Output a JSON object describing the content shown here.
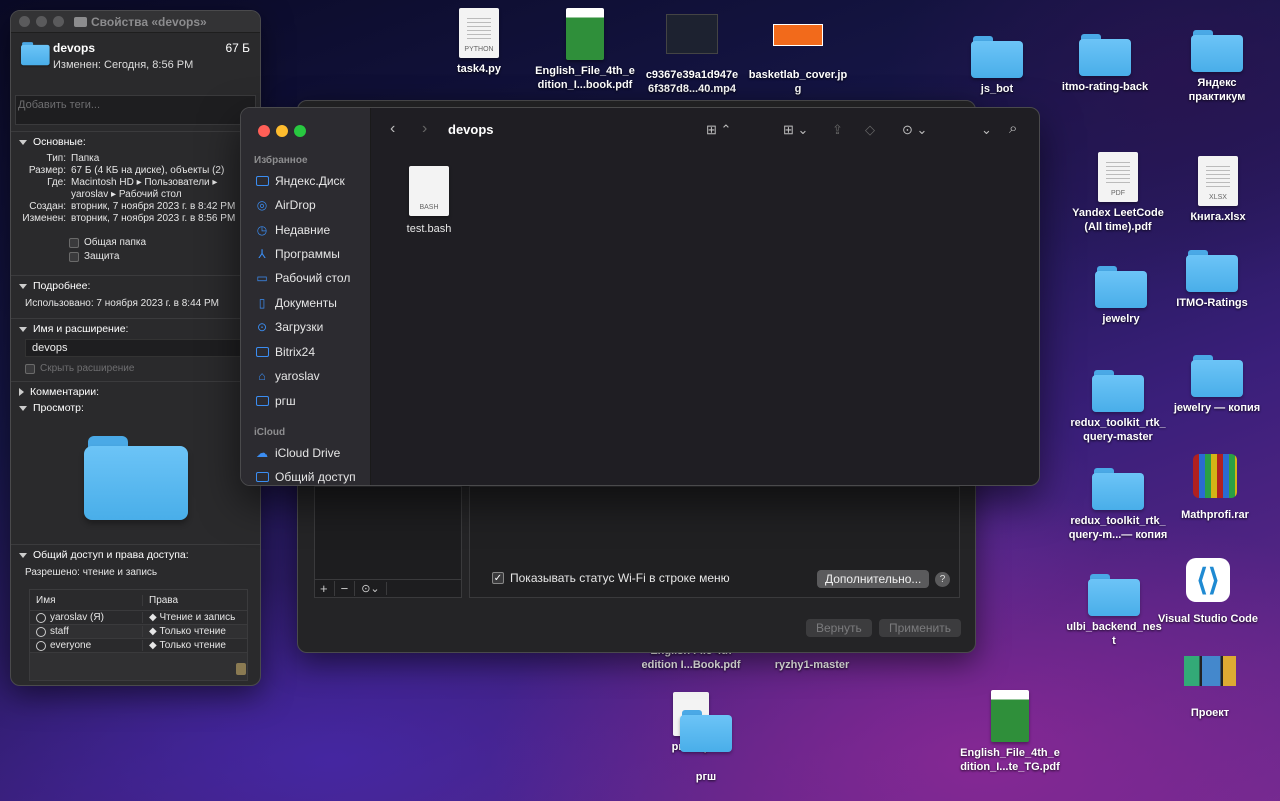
{
  "desktop": {
    "items": [
      {
        "label": "task4.py",
        "kind": "doc",
        "ext": "PYTHON"
      },
      {
        "label": "English_File_4th_e\ndition_I...book.pdf",
        "kind": "book"
      },
      {
        "label": "c9367e39a1d947e\n6f387d8...40.mp4",
        "kind": "video"
      },
      {
        "label": "basketlab_cover.jp\ng",
        "kind": "image"
      },
      {
        "label": "js_bot",
        "kind": "folder"
      },
      {
        "label": "itmo-rating-back",
        "kind": "folder"
      },
      {
        "label": "Яндекс\nпрактикум",
        "kind": "folder"
      },
      {
        "label": "Yandex LeetCode\n(All time).pdf",
        "kind": "doc",
        "ext": "PDF"
      },
      {
        "label": "Книга.xlsx",
        "kind": "doc",
        "ext": "XLSX"
      },
      {
        "label": "jewelry",
        "kind": "folder"
      },
      {
        "label": "ITMO-Ratings",
        "kind": "folder"
      },
      {
        "label": "jewelry — копия",
        "kind": "folder"
      },
      {
        "label": "redux_toolkit_rtk_\nquery-master",
        "kind": "folder"
      },
      {
        "label": "Mathprofi.rar",
        "kind": "rar"
      },
      {
        "label": "redux_toolkit_rtk_\nquery-m...— копия",
        "kind": "folder"
      },
      {
        "label": "Visual Studio Code",
        "kind": "app"
      },
      {
        "label": "ulbi_backend_nes\nt",
        "kind": "folder"
      },
      {
        "label": "Проект",
        "kind": "app"
      },
      {
        "label": "English File 4th\nedition I...Book.pdf",
        "kind": "doc"
      },
      {
        "label": "ryzhy1-master",
        "kind": "folder"
      },
      {
        "label": "ргш.zip",
        "kind": "doc"
      },
      {
        "label": "ргш",
        "kind": "folder"
      },
      {
        "label": "English_File_4th_e\ndition_I...te_TG.pdf",
        "kind": "book"
      }
    ]
  },
  "info_window": {
    "title": "Свойства «devops»",
    "name": "devops",
    "size": "67 Б",
    "modified": "Изменен: Сегодня, 8:56 PM",
    "tags_placeholder": "Добавить теги...",
    "general_header": "Основные:",
    "general": [
      {
        "k": "Тип:",
        "v": "Папка"
      },
      {
        "k": "Размер:",
        "v": "67 Б (4 КБ на диске), объекты (2)"
      },
      {
        "k": "Где:",
        "v": "Macintosh HD ▸ Пользователи ▸"
      },
      {
        "k": "",
        "v": "yaroslav ▸ Рабочий стол"
      },
      {
        "k": "Создан:",
        "v": "вторник, 7 ноября 2023 г. в 8:42 PM"
      },
      {
        "k": "Изменен:",
        "v": "вторник, 7 ноября 2023 г. в 8:56 PM"
      }
    ],
    "shared_folder": "Общая папка",
    "locked": "Защита",
    "more_header": "Подробнее:",
    "last_used": "Использовано: 7 ноября 2023 г. в 8:44 PM",
    "name_ext_header": "Имя и расширение:",
    "name_field": "devops",
    "hide_ext": "Скрыть расширение",
    "comments_header": "Комментарии:",
    "preview_header": "Просмотр:",
    "sharing_header": "Общий доступ и права доступа:",
    "permission_text": "Разрешено: чтение и запись",
    "col_name": "Имя",
    "col_priv": "Права",
    "perms": [
      {
        "name": "yaroslav (Я)",
        "priv": "◆ Чтение и запись"
      },
      {
        "name": "staff",
        "priv": "◆ Только чтение"
      },
      {
        "name": "everyone",
        "priv": "◆ Только чтение"
      }
    ],
    "plus": "+",
    "minus": "−",
    "action": "⊙⌄"
  },
  "settings_window": {
    "wifi_label": "Показывать статус Wi-Fi в строке меню",
    "advanced": "Дополнительно...",
    "help": "?",
    "revert": "Вернуть",
    "apply": "Применить",
    "plus": "+",
    "minus": "−",
    "action": "⊙⌄"
  },
  "finder": {
    "title": "devops",
    "favorites_header": "Избранное",
    "favorites": [
      {
        "label": "Яндекс.Диск",
        "icon": "folder-icon"
      },
      {
        "label": "AirDrop",
        "icon": "airdrop-icon"
      },
      {
        "label": "Недавние",
        "icon": "clock-icon"
      },
      {
        "label": "Программы",
        "icon": "apps-icon"
      },
      {
        "label": "Рабочий стол",
        "icon": "desktop-icon"
      },
      {
        "label": "Документы",
        "icon": "document-icon"
      },
      {
        "label": "Загрузки",
        "icon": "download-icon"
      },
      {
        "label": "Bitrix24",
        "icon": "folder-icon"
      },
      {
        "label": "yaroslav",
        "icon": "home-icon"
      },
      {
        "label": "ргш",
        "icon": "folder-icon"
      }
    ],
    "icloud_header": "iCloud",
    "icloud": [
      {
        "label": "iCloud Drive",
        "icon": "cloud-icon"
      },
      {
        "label": "Общий доступ",
        "icon": "shared-folder-icon"
      }
    ],
    "files": [
      {
        "label": "test.bash",
        "ext": "BASH"
      }
    ]
  },
  "colors": {
    "accent": "#3b8df2",
    "folder": "#49aee9"
  }
}
